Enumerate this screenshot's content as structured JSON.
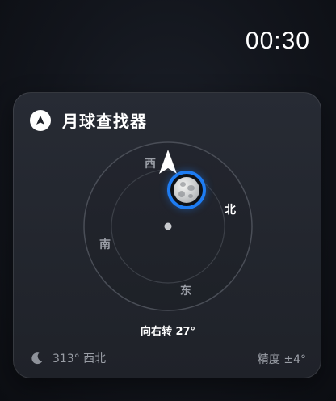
{
  "status": {
    "time": "00:30"
  },
  "widget": {
    "title": "月球查找器",
    "header_icon": "navigation-arrow-icon",
    "directions": {
      "west": "西",
      "north": "北",
      "south": "南",
      "east": "东"
    },
    "hint": "向右转 27°",
    "azimuth": "313° 西北",
    "azimuth_icon": "crescent-moon-icon",
    "accuracy": "精度 ±4°",
    "colors": {
      "accent": "#1e7cf2",
      "muted_text": "#9a9ea6",
      "card_bg": "#24272f"
    }
  }
}
